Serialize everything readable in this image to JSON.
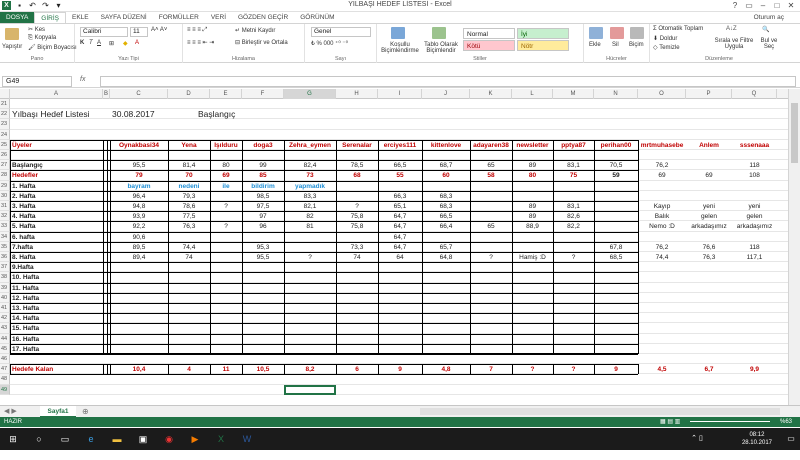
{
  "window": {
    "title": "YILBAŞI HEDEF LİSTESİ - Excel",
    "user": "Oturum aç"
  },
  "tabs": [
    "DOSYA",
    "GİRİŞ",
    "EKLE",
    "SAYFA DÜZENİ",
    "FORMÜLLER",
    "VERİ",
    "GÖZDEN GEÇİR",
    "GÖRÜNÜM"
  ],
  "ribbon": {
    "clipboard": {
      "paste": "Yapıştır",
      "cut": "Kes",
      "copy": "Kopyala",
      "format_painter": "Biçim Boyacısı",
      "group": "Pano"
    },
    "font": {
      "name": "Calibri",
      "size": "11",
      "group": "Yazı Tipi"
    },
    "alignment": {
      "wrap": "Metni Kaydır",
      "merge": "Birleştir ve Ortala",
      "group": "Hizalama"
    },
    "number": {
      "format": "Genel",
      "group": "Sayı"
    },
    "styles": {
      "conditional": "Koşullu Biçimlendirme",
      "table": "Tablo Olarak Biçimlendir",
      "normal": "Normal",
      "good": "İyi",
      "bad": "Kötü",
      "neutral": "Nötr",
      "group": "Stiller"
    },
    "cells": {
      "insert": "Ekle",
      "delete": "Sil",
      "format": "Biçim",
      "group": "Hücreler"
    },
    "editing": {
      "autosum": "Otomatik Toplam",
      "fill": "Doldur",
      "clear": "Temizle",
      "sort": "Sırala ve Filtre Uygula",
      "find": "Bul ve Seç",
      "group": "Düzenleme"
    }
  },
  "namebox": "G49",
  "fx": "fx",
  "columns": [
    "A",
    "B",
    "C",
    "D",
    "E",
    "F",
    "G",
    "H",
    "I",
    "J",
    "K",
    "L",
    "M",
    "N",
    "O",
    "P",
    "Q"
  ],
  "sheet": {
    "row_numbers": [
      "21",
      "22",
      "23",
      "24",
      "25",
      "26",
      "27",
      "28",
      "29",
      "30",
      "31",
      "32",
      "33",
      "34",
      "35",
      "36",
      "37",
      "38",
      "39",
      "40",
      "41",
      "42",
      "43",
      "44",
      "45",
      "46",
      "47",
      "48",
      "49"
    ],
    "title": "Yılbaşı Hedef Listesi",
    "date": "30.08.2017",
    "start_label": "Başlangıç",
    "members_label": "Üyeler",
    "members": [
      "Oynakbasi34",
      "Yena",
      "Işılduru",
      "doga3",
      "Zehra_eymen",
      "Serenalar",
      "erciyes111",
      "kittenlove",
      "adayaren38",
      "newsletter",
      "pptya87",
      "perihan00",
      "mrtmuhasebe",
      "Anlem",
      "sssenaaa"
    ],
    "row_labels": [
      "Başlangıç",
      "Hedefler",
      "1. Hafta",
      "2. Hafta",
      "3. Hafta",
      "4. Hafta",
      "5. Hafta",
      "6. hafta",
      "7.hafta",
      "8. Hafta",
      "9.Hafta",
      "10. Hafta",
      "11. Hafta",
      "12. Hafta",
      "13. Hafta",
      "14. Hafta",
      "15. Hafta",
      "16. Hafta",
      "17. Hafta"
    ],
    "rows": [
      [
        "95,5",
        "81,4",
        "80",
        "99",
        "82,4",
        "78,5",
        "66,5",
        "68,7",
        "65",
        "89",
        "83,1",
        "70,5",
        "76,2",
        "",
        "118"
      ],
      [
        "79",
        "70",
        "69",
        "85",
        "73",
        "68",
        "55",
        "60",
        "58",
        "80",
        "75",
        "59",
        "69",
        "69",
        "108"
      ],
      [
        "bayram",
        "nedeni",
        "ile",
        "bildirim",
        "yapmadık",
        "",
        "",
        "",
        "",
        "",
        "",
        "",
        "",
        "",
        ""
      ],
      [
        "96,4",
        "79,3",
        "",
        "98,5",
        "83,3",
        "",
        "66,3",
        "68,3",
        "",
        "",
        "",
        "",
        "",
        "",
        ""
      ],
      [
        "94,8",
        "78,6",
        "?",
        "97,5",
        "82,1",
        "?",
        "65,1",
        "68,3",
        "",
        "89",
        "83,1",
        "",
        "Kayıp",
        "yeni",
        "yeni"
      ],
      [
        "93,9",
        "77,5",
        "",
        "97",
        "82",
        "75,8",
        "64,7",
        "66,5",
        "",
        "89",
        "82,6",
        "",
        "Balık",
        "gelen",
        "gelen"
      ],
      [
        "92,2",
        "76,3",
        "?",
        "96",
        "81",
        "75,8",
        "64,7",
        "66,4",
        "65",
        "88,9",
        "82,2",
        "",
        "Nemo :D",
        "arkadaşımız",
        "arkadaşımız"
      ],
      [
        "90,6",
        "",
        "",
        "",
        "",
        "",
        "64,7",
        "",
        "",
        "",
        "",
        "",
        "",
        "",
        ""
      ],
      [
        "89,5",
        "74,4",
        "",
        "95,3",
        "",
        "73,3",
        "64,7",
        "65,7",
        "",
        "",
        "",
        "67,8",
        "76,2",
        "76,6",
        "118"
      ],
      [
        "89,4",
        "74",
        "",
        "95,5",
        "?",
        "74",
        "64",
        "64,8",
        "?",
        "Hamiş :D",
        "?",
        "68,5",
        "74,4",
        "76,3",
        "117,1"
      ]
    ],
    "remaining_label": "Hedefe Kalan",
    "remaining": [
      "10,4",
      "4",
      "11",
      "10,5",
      "8,2",
      "6",
      "9",
      "4,8",
      "7",
      "?",
      "?",
      "9",
      "4,5",
      "6,7",
      "9,9"
    ]
  },
  "sheet_tab": "Sayfa1",
  "status": {
    "mode": "HAZIR",
    "zoom": "%63"
  },
  "clock": {
    "time": "08:12",
    "date": "28.10.2017"
  },
  "colors": {
    "excel_green": "#217346",
    "red_text": "#c00000",
    "blue_text": "#1f8fd6"
  }
}
